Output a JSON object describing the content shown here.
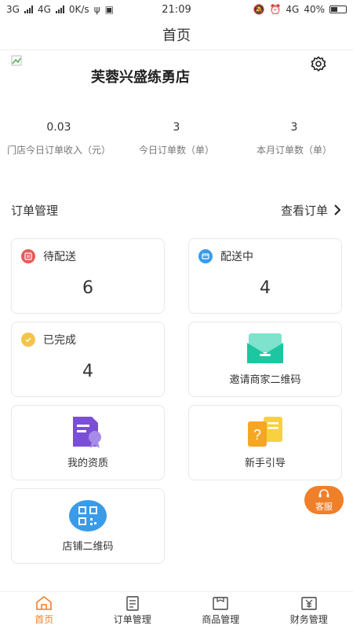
{
  "status_bar": {
    "left_text": [
      "3G",
      "4G",
      "0K/s"
    ],
    "time": "21:09",
    "right_text": [
      "4G",
      "40%"
    ]
  },
  "title": "首页",
  "store": {
    "name": "芙蓉兴盛练勇店"
  },
  "stats": [
    {
      "value": "0.03",
      "label": "门店今日订单收入（元）"
    },
    {
      "value": "3",
      "label": "今日订单数（单）"
    },
    {
      "value": "3",
      "label": "本月订单数（单）"
    }
  ],
  "order_section": {
    "title": "订单管理",
    "link": "查看订单"
  },
  "cards": {
    "pending": {
      "label": "待配送",
      "count": "6",
      "color": "#e85a5a"
    },
    "delivering": {
      "label": "配送中",
      "count": "4",
      "color": "#3a9be8"
    },
    "completed": {
      "label": "已完成",
      "count": "4",
      "color": "#f2c44a"
    },
    "invite": {
      "label": "邀请商家二维码",
      "color": "#1cc6a0"
    },
    "qualification": {
      "label": "我的资质",
      "color": "#7a4fd6"
    },
    "guide": {
      "label": "新手引导",
      "color": "#f5a623"
    },
    "store_qr": {
      "label": "店铺二维码",
      "color": "#3a9be8"
    }
  },
  "service": {
    "label": "客服",
    "color": "#f07f2a"
  },
  "tabs": [
    {
      "label": "首页",
      "icon": "home-icon",
      "active": true
    },
    {
      "label": "订单管理",
      "icon": "orders-icon",
      "active": false
    },
    {
      "label": "商品管理",
      "icon": "goods-icon",
      "active": false
    },
    {
      "label": "财务管理",
      "icon": "finance-icon",
      "active": false
    }
  ]
}
